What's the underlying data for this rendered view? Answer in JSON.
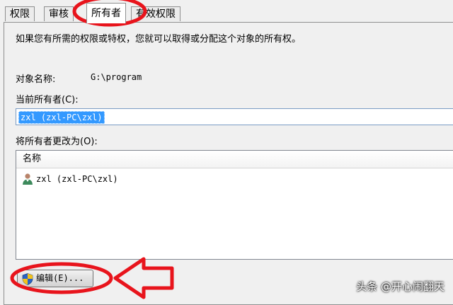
{
  "tabs": [
    {
      "label": "权限",
      "active": false
    },
    {
      "label": "审核",
      "active": false
    },
    {
      "label": "所有者",
      "active": true
    },
    {
      "label": "有效权限",
      "active": false
    }
  ],
  "description": "如果您有所需的权限或特权，您就可以取得或分配这个对象的所有权。",
  "object_name": {
    "label": "对象名称:",
    "value": "G:\\program"
  },
  "current_owner": {
    "label": "当前所有者(C):",
    "value": "zxl (zxl-PC\\zxl)"
  },
  "change_owner": {
    "label": "将所有者更改为(O):"
  },
  "owners_list": {
    "column_header": "名称",
    "rows": [
      {
        "name": "zxl (zxl-PC\\zxl)",
        "icon": "user-icon"
      }
    ]
  },
  "edit_button": {
    "label": "编辑(E)...",
    "icon": "uac-shield-icon"
  },
  "watermark": "头条 @开心闹翻天",
  "annotation_color": "#e8141c"
}
